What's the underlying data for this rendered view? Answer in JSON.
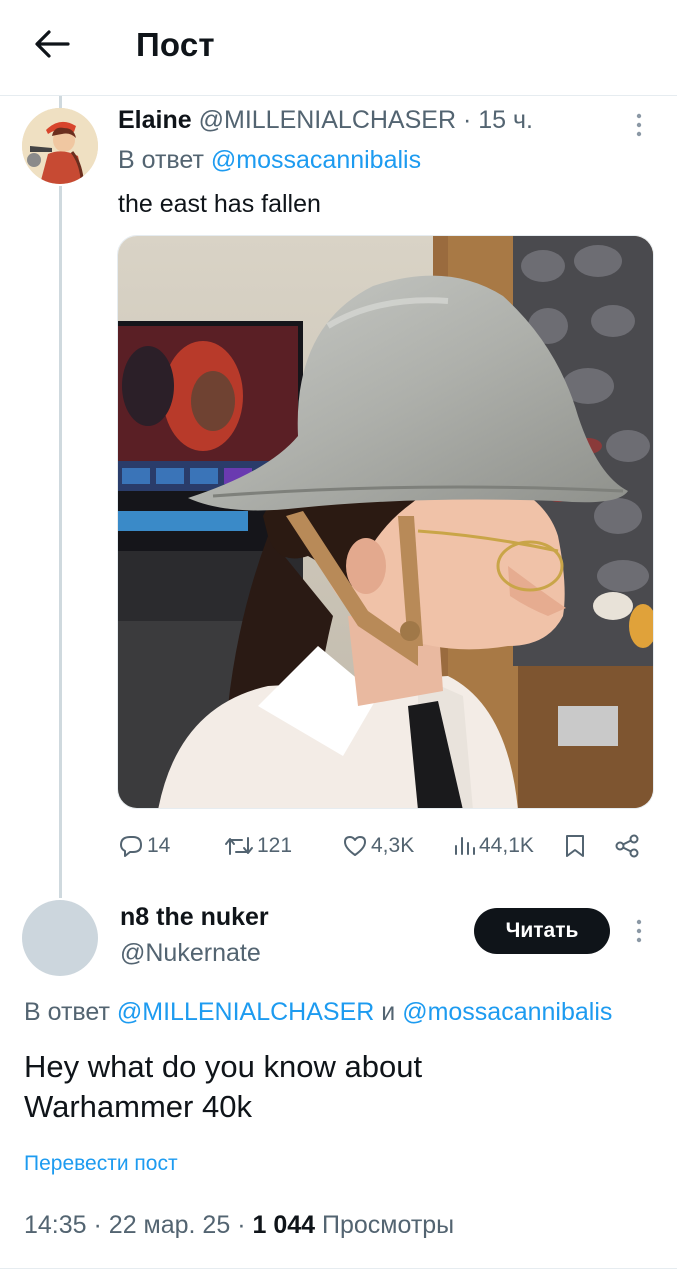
{
  "header": {
    "title": "Пост"
  },
  "tweet1": {
    "author_name": "Elaine",
    "author_handle": "@MILLENIALCHASER",
    "separator": "·",
    "time": "15 ч.",
    "reply_prefix": "В ответ",
    "reply_mention": "@mossacannibalis",
    "text": "the east has fallen",
    "stats": {
      "replies": "14",
      "retweets": "121",
      "likes": "4,3K",
      "views": "44,1K"
    }
  },
  "tweet2": {
    "author_name": "n8 the nuker",
    "author_handle": "@Nukernate",
    "follow_label": "Читать",
    "reply_prefix": "В ответ",
    "reply_mention_1": "@MILLENIALCHASER",
    "reply_conj": "и",
    "reply_mention_2": "@mossacannibalis",
    "text_line1": "Hey what do you know about",
    "text_line2": "Warhammer 40k",
    "translate_label": "Перевести пост",
    "time": "14:35",
    "date": "22 мар. 25",
    "separator": "·",
    "views_count": "1 044",
    "views_label": "Просмотры"
  },
  "icons": {
    "back": "arrow-left-icon",
    "more": "more-vertical-icon",
    "reply": "comment-icon",
    "retweet": "retweet-icon",
    "like": "heart-icon",
    "views": "views-bar-icon",
    "bookmark": "bookmark-icon",
    "share": "share-icon"
  },
  "colors": {
    "accent": "#1d9bf0",
    "text": "#0f1419",
    "secondary": "#536471",
    "button": "#0f1419"
  }
}
